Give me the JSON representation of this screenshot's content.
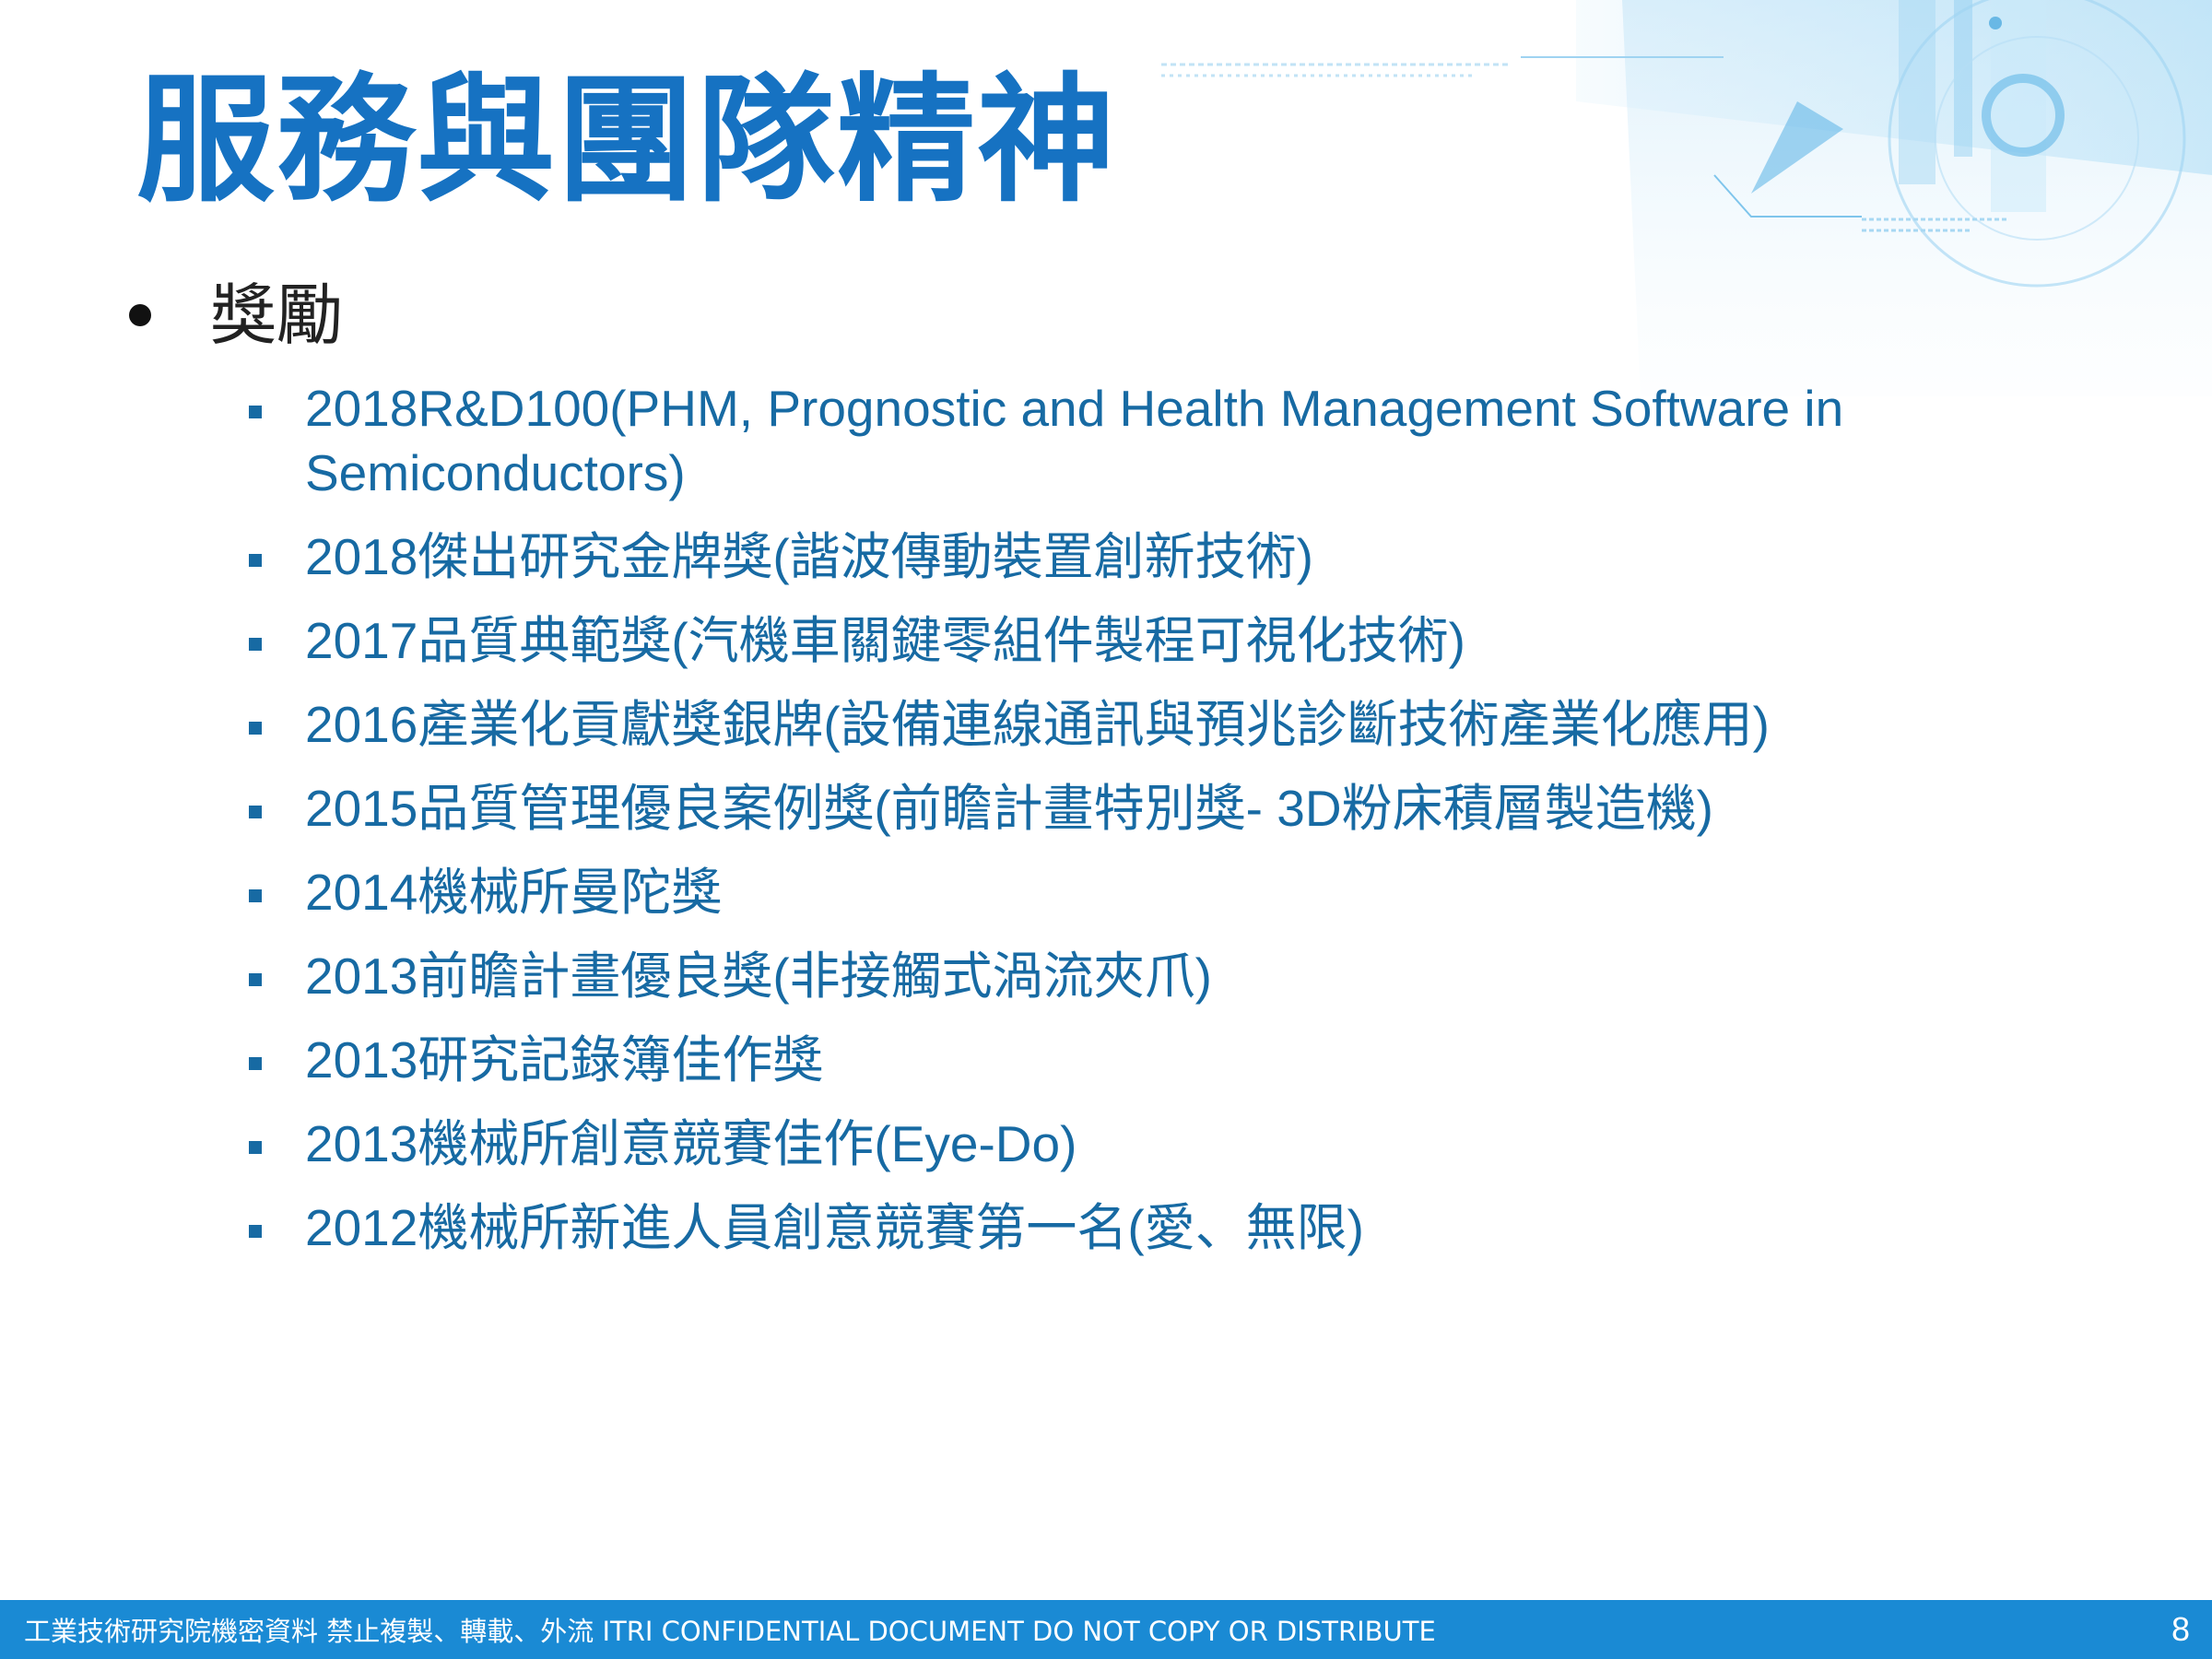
{
  "slide": {
    "title": "服務與團隊精神",
    "bullet": "獎勵",
    "awards": [
      "2018R&D100(PHM, Prognostic and Health Management Software in Semiconductors)",
      "2018傑出研究金牌獎(諧波傳動裝置創新技術)",
      "2017品質典範獎(汽機車關鍵零組件製程可視化技術)",
      "2016產業化貢獻獎銀牌(設備連線通訊與預兆診斷技術產業化應用)",
      "2015品質管理優良案例獎(前瞻計畫特別獎- 3D粉床積層製造機)",
      "2014機械所曼陀獎",
      "2013前瞻計畫優良獎(非接觸式渦流夾爪)",
      "2013研究記錄簿佳作獎",
      "2013機械所創意競賽佳作(Eye-Do)",
      "2012機械所新進人員創意競賽第一名(愛、無限)"
    ]
  },
  "footer": {
    "confidential_text": "工業技術研究院機密資料 禁止複製、轉載、外流  ITRI CONFIDENTIAL DOCUMENT DO NOT COPY OR DISTRIBUTE",
    "page_number": "8"
  },
  "colors": {
    "title": "#1672c2",
    "body_text": "#176aa3",
    "footer_bar": "#1a8ad4"
  }
}
